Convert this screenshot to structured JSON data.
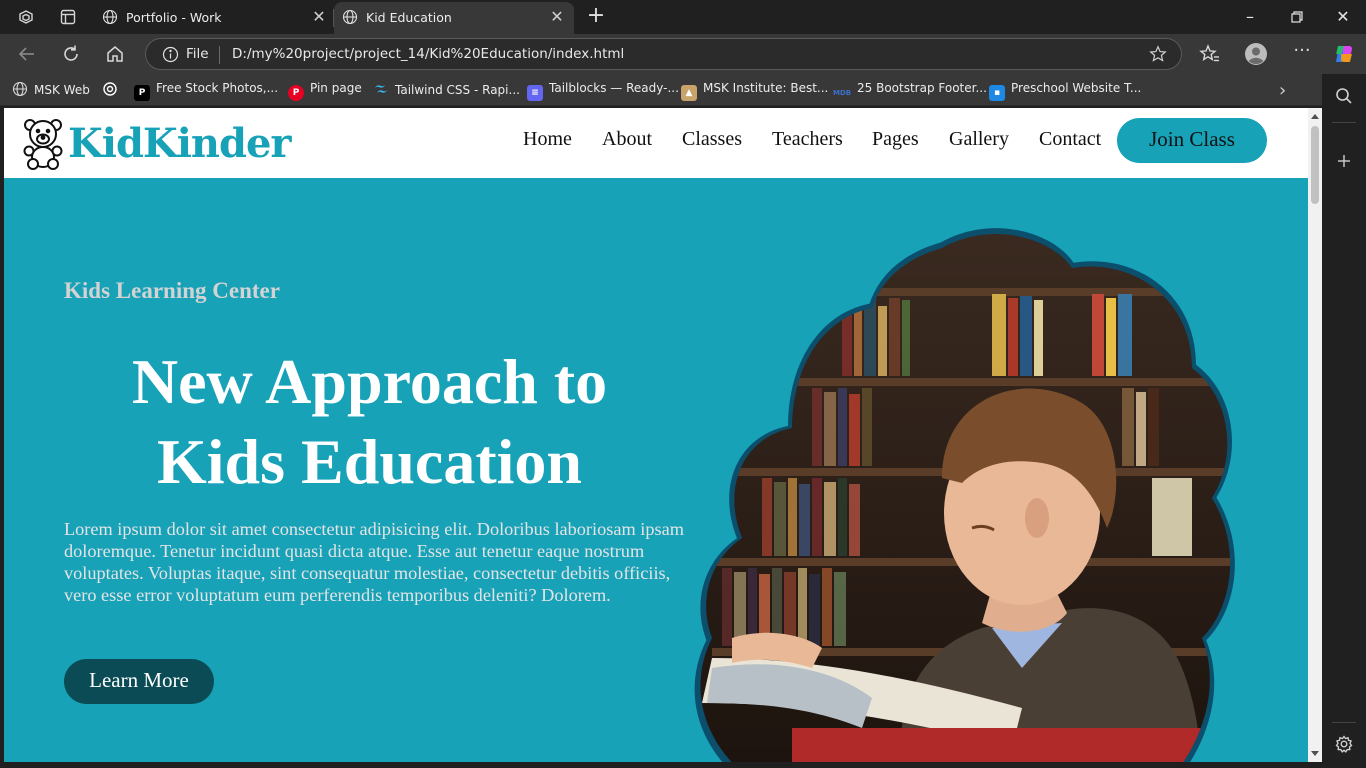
{
  "browser": {
    "tabs": [
      {
        "title": "Portfolio - Work"
      },
      {
        "title": "Kid Education"
      }
    ],
    "address": {
      "scheme_label": "File",
      "url": "D:/my%20project/project_14/Kid%20Education/index.html"
    },
    "bookmarks": [
      {
        "label": "MSK Web",
        "icon": "globe-icon",
        "color": "#cccccc"
      },
      {
        "label": "",
        "icon": "openai-icon",
        "color": "#ffffff"
      },
      {
        "label": "Free Stock Photos,...",
        "icon": "pexels-icon",
        "color": "#05a081"
      },
      {
        "label": "Pin page",
        "icon": "pinterest-icon",
        "color": "#e60023"
      },
      {
        "label": "Tailwind CSS - Rapi...",
        "icon": "tailwind-icon",
        "color": "#38bdf8"
      },
      {
        "label": "Tailblocks — Ready-...",
        "icon": "tailblocks-icon",
        "color": "#6366f1"
      },
      {
        "label": "MSK Institute: Best...",
        "icon": "msk-icon",
        "color": "#c9a36b"
      },
      {
        "label": "25 Bootstrap Footer...",
        "icon": "mdb-icon",
        "color": "#3b71ca"
      },
      {
        "label": "Preschool Website T...",
        "icon": "site-icon",
        "color": "#1e88e5"
      }
    ]
  },
  "site": {
    "logo": "KidKinder",
    "nav": [
      "Home",
      "About",
      "Classes",
      "Teachers",
      "Pages",
      "Gallery",
      "Contact"
    ],
    "cta": "Join Class",
    "accent": "#17a2b8",
    "dark": "#0b4b55"
  },
  "hero": {
    "subtitle": "Kids Learning Center",
    "title_line1": "New Approach to",
    "title_line2": "Kids Education",
    "text": "Lorem ipsum dolor sit amet consectetur adipisicing elit. Doloribus laboriosam ipsam doloremque. Tenetur incidunt quasi dicta atque. Esse aut tenetur eaque nostrum voluptates. Voluptas itaque, sint consequatur molestiae, consectetur debitis officiis, vero esse error voluptatum eum perferendis temporibus deleniti? Dolorem.",
    "button": "Learn More",
    "image": "boy-reading-book-photo"
  }
}
